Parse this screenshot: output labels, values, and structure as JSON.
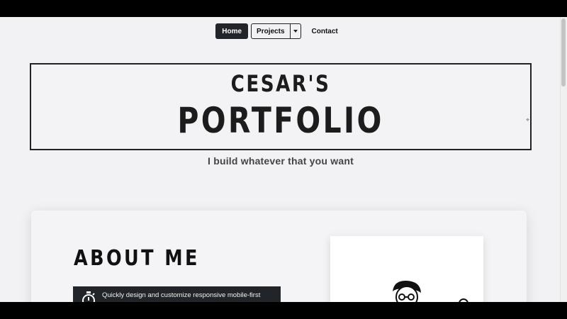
{
  "nav": {
    "home_label": "Home",
    "projects_label": "Projects",
    "contact_label": "Contact"
  },
  "hero": {
    "line1": "CESAR'S",
    "line2": "PORTFOLIO",
    "tagline": "I build whatever that you want"
  },
  "about": {
    "heading": "ABOUT ME",
    "feature_icon": "stopwatch-icon",
    "feature_text": "Quickly design and customize responsive mobile-first sites with Bootstrap, the world's most popular front-end"
  },
  "colors": {
    "page_bg": "#f2f2f4",
    "dark": "#212529",
    "text": "#1c1c1c"
  }
}
